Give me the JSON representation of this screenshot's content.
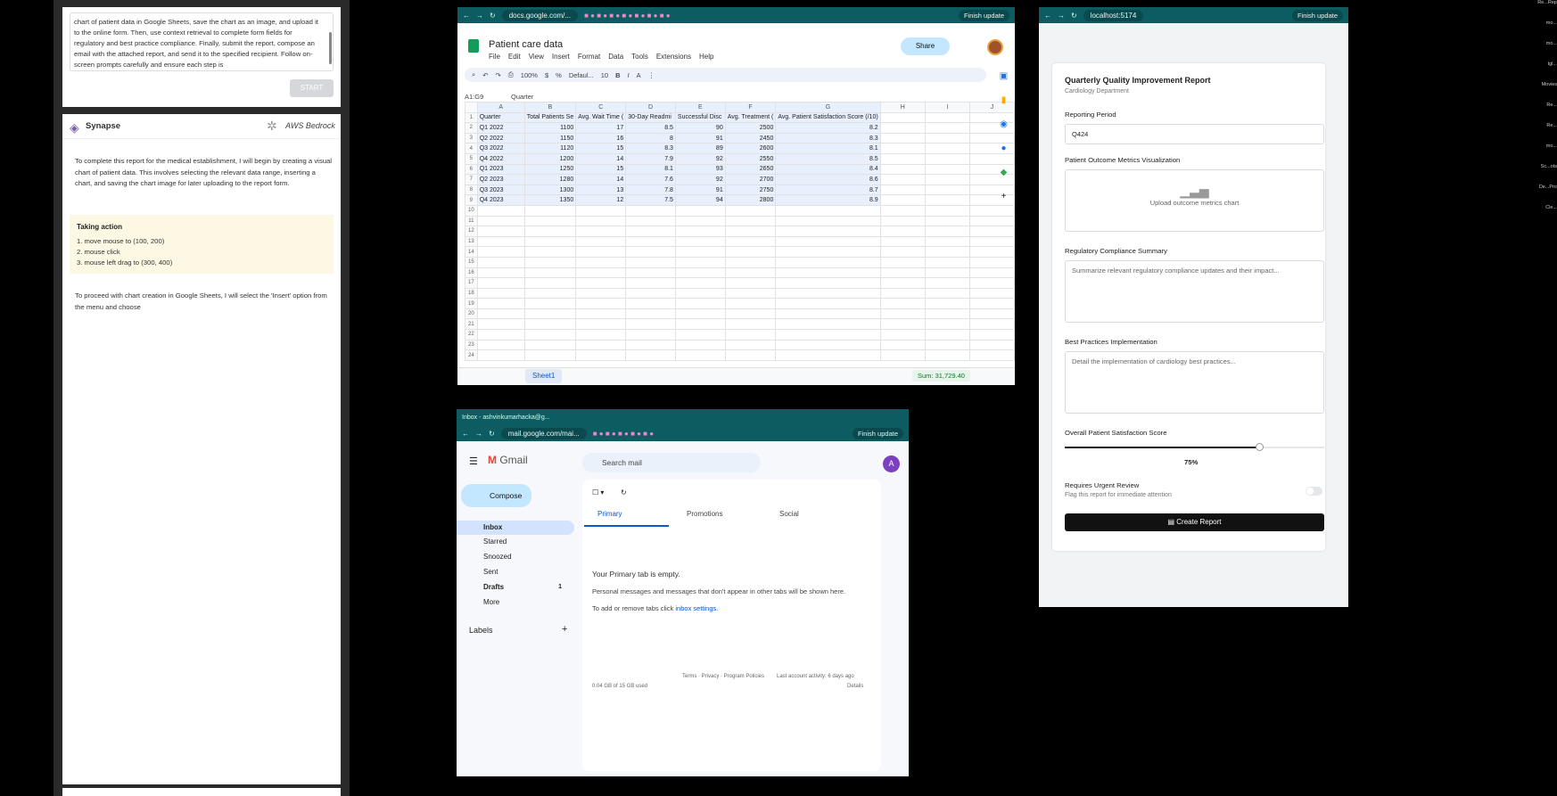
{
  "agent_panel": {
    "task_text": "chart of patient data in Google Sheets, save the chart as an image, and upload it to the online form. Then, use context retrieval to complete form fields for regulatory and best practice compliance. Finally, submit the report, compose an email with the attached report, and send it to the specified recipient. Follow on-screen prompts carefully and ensure each step is",
    "start_label": "START",
    "app_name": "Synapse",
    "provider_name": "AWS Bedrock",
    "message_1": "To complete this report for the medical establishment, I will begin by creating a visual chart of patient data. This involves selecting the relevant data range, inserting a chart, and saving the chart image for later uploading to the report form.",
    "action_title": "Taking action",
    "actions": [
      "1. move mouse to (100, 200)",
      "2. mouse click",
      "3. mouse left drag to (300, 400)"
    ],
    "message_2": "To proceed with chart creation in Google Sheets, I will select the 'Insert' option from the menu and choose"
  },
  "sheets": {
    "url": "docs.google.com/...",
    "finish_update": "Finish update",
    "title": "Patient care data",
    "menu": [
      "File",
      "Edit",
      "View",
      "Insert",
      "Format",
      "Data",
      "Tools",
      "Extensions",
      "Help"
    ],
    "share_label": "Share",
    "zoom": "100%",
    "font": "Defaul...",
    "font_size": "10",
    "name_box": "A1:G9",
    "formula_value": "Quarter",
    "columns": [
      "A",
      "B",
      "C",
      "D",
      "E",
      "F",
      "G",
      "H",
      "I",
      "J"
    ],
    "headers": [
      "Quarter",
      "Total Patients Se",
      "Avg. Wait Time (",
      "30-Day Readmi",
      "Successful Disc",
      "Avg. Treatment (",
      "Avg. Patient Satisfaction Score (/10)"
    ],
    "rows": [
      [
        "Q1 2022",
        "1100",
        "17",
        "8.5",
        "90",
        "2500",
        "8.2"
      ],
      [
        "Q2 2022",
        "1150",
        "16",
        "8",
        "91",
        "2450",
        "8.3"
      ],
      [
        "Q3 2022",
        "1120",
        "15",
        "8.3",
        "89",
        "2600",
        "8.1"
      ],
      [
        "Q4 2022",
        "1200",
        "14",
        "7.9",
        "92",
        "2550",
        "8.5"
      ],
      [
        "Q1 2023",
        "1250",
        "15",
        "8.1",
        "93",
        "2650",
        "8.4"
      ],
      [
        "Q2 2023",
        "1280",
        "14",
        "7.6",
        "92",
        "2700",
        "8.6"
      ],
      [
        "Q3 2023",
        "1300",
        "13",
        "7.8",
        "91",
        "2750",
        "8.7"
      ],
      [
        "Q4 2023",
        "1350",
        "12",
        "7.5",
        "94",
        "2800",
        "8.9"
      ]
    ],
    "row_numbers": [
      "1",
      "2",
      "3",
      "4",
      "5",
      "6",
      "7",
      "8",
      "9",
      "10",
      "11",
      "12",
      "13",
      "14",
      "15",
      "16",
      "17",
      "18",
      "19",
      "20",
      "21",
      "22",
      "23",
      "24"
    ],
    "sheet_tab": "Sheet1",
    "sum": "Sum: 31,729.40"
  },
  "gmail": {
    "tab_title": "Inbox - ashvinkumarhacka@g...",
    "url": "mail.google.com/mai...",
    "finish_update": "Finish update",
    "brand": "Gmail",
    "compose": "Compose",
    "search_placeholder": "Search mail",
    "nav": [
      {
        "label": "Inbox",
        "count": ""
      },
      {
        "label": "Starred",
        "count": ""
      },
      {
        "label": "Snoozed",
        "count": ""
      },
      {
        "label": "Sent",
        "count": ""
      },
      {
        "label": "Drafts",
        "count": "1"
      },
      {
        "label": "More",
        "count": ""
      }
    ],
    "labels_heading": "Labels",
    "tabs": [
      "Primary",
      "Promotions",
      "Social"
    ],
    "empty_title": "Your Primary tab is empty.",
    "empty_desc": "Personal messages and messages that don't appear in other tabs will be shown here.",
    "empty_hint": "To add or remove tabs click",
    "settings_link": "inbox settings.",
    "footer_links": "Terms · Privacy · Program Policies",
    "last_activity": "Last account activity: 6 days ago",
    "details": "Details",
    "storage": "0.04 GB of 15 GB used",
    "avatar_letter": "A"
  },
  "report": {
    "url": "localhost:5174",
    "finish_update": "Finish update",
    "title": "Quarterly Quality Improvement Report",
    "subtitle": "Cardiology Department",
    "reporting_period_label": "Reporting Period",
    "reporting_period_value": "Q424",
    "metrics_label": "Patient Outcome Metrics Visualization",
    "upload_label": "Upload outcome metrics chart",
    "compliance_label": "Regulatory Compliance Summary",
    "compliance_placeholder": "Summarize relevant regulatory compliance updates and their impact...",
    "best_practices_label": "Best Practices Implementation",
    "best_practices_placeholder": "Detail the implementation of cardiology best practices...",
    "satisfaction_label": "Overall Patient Satisfaction Score",
    "satisfaction_value": 0.75,
    "satisfaction_text": "75%",
    "urgent_label": "Requires Urgent Review",
    "urgent_desc": "Flag this report for immediate attention",
    "urgent_on": false,
    "create_label": "Create Report"
  },
  "desktop_icons": [
    "Re...Rep",
    "mo...",
    "mo...",
    "tgl...",
    "Movies",
    "Re...",
    "Re...",
    "mo...",
    "Sc...ots",
    "De...Pro",
    "Cle..."
  ]
}
